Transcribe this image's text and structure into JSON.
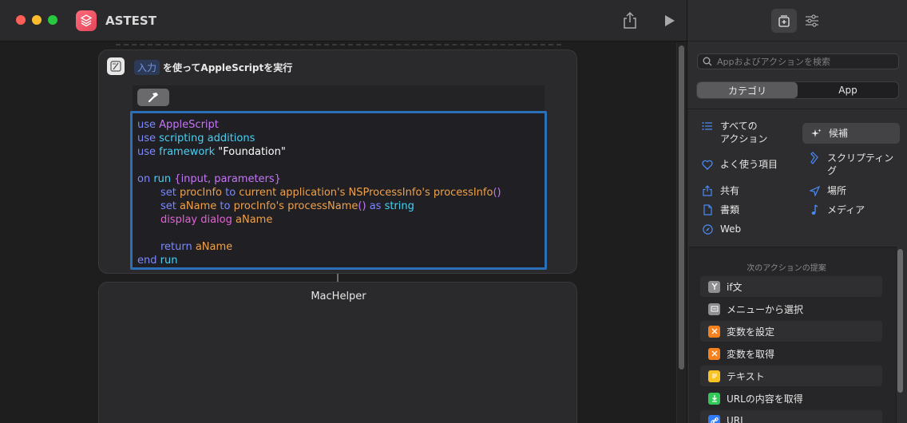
{
  "window": {
    "title": "ASTEST"
  },
  "action": {
    "input_token": "入力",
    "header_text": "を使ってAppleScriptを実行",
    "code_lines": [
      [
        [
          "kw",
          "use "
        ],
        [
          "cls",
          "AppleScript"
        ]
      ],
      [
        [
          "kw",
          "use "
        ],
        [
          "cmd",
          "scripting additions"
        ]
      ],
      [
        [
          "kw",
          "use "
        ],
        [
          "cmd",
          "framework "
        ],
        [
          "str",
          "\"Foundation\""
        ]
      ],
      [],
      [
        [
          "kw",
          "on "
        ],
        [
          "evt",
          "run "
        ],
        [
          "par",
          "{input, parameters}"
        ]
      ],
      [
        [
          "plain",
          "\t"
        ],
        [
          "kw",
          "set "
        ],
        [
          "var",
          "procInfo "
        ],
        [
          "kw",
          "to "
        ],
        [
          "var",
          "current application's "
        ],
        [
          "var",
          "NSProcessInfo's "
        ],
        [
          "var",
          "processInfo"
        ],
        [
          "par",
          "()"
        ]
      ],
      [
        [
          "plain",
          "\t"
        ],
        [
          "kw",
          "set "
        ],
        [
          "var",
          "aName "
        ],
        [
          "kw",
          "to "
        ],
        [
          "var",
          "procInfo's "
        ],
        [
          "var",
          "processName"
        ],
        [
          "par",
          "() "
        ],
        [
          "kw",
          "as "
        ],
        [
          "cmd",
          "string"
        ]
      ],
      [
        [
          "plain",
          "\t"
        ],
        [
          "dlg",
          "display dialog "
        ],
        [
          "var",
          "aName"
        ]
      ],
      [],
      [
        [
          "plain",
          "\t"
        ],
        [
          "kw",
          "return "
        ],
        [
          "var",
          "aName"
        ]
      ],
      [
        [
          "kw",
          "end "
        ],
        [
          "evt",
          "run"
        ]
      ]
    ]
  },
  "helper": {
    "title": "MacHelper"
  },
  "sidebar": {
    "search_placeholder": "Appおよびアクションを検索",
    "segments": [
      "カテゴリ",
      "App"
    ],
    "categories": {
      "all": "すべての\nアクション",
      "suggestions": "候補",
      "favorites": "よく使う項目",
      "scripting": "スクリプティン\nグ",
      "sharing": "共有",
      "location": "場所",
      "documents": "書類",
      "media": "メディア",
      "web": "Web"
    },
    "suggestions_title": "次のアクションの提案",
    "suggestions": [
      {
        "label": "if文",
        "icon": "if-icon",
        "color": "#8e8e93"
      },
      {
        "label": "メニューから選択",
        "icon": "menu-icon",
        "color": "#8e8e93"
      },
      {
        "label": "変数を設定",
        "icon": "variable-icon",
        "color": "#f5821f"
      },
      {
        "label": "変数を取得",
        "icon": "variable-icon",
        "color": "#f5821f"
      },
      {
        "label": "テキスト",
        "icon": "text-icon",
        "color": "#f7c325"
      },
      {
        "label": "URLの内容を取得",
        "icon": "download-icon",
        "color": "#33c759"
      },
      {
        "label": "URL",
        "icon": "link-icon",
        "color": "#2f7cf6"
      }
    ]
  },
  "colors": {
    "accent": "#2a6fb8",
    "app_icon": "#e2465a"
  }
}
